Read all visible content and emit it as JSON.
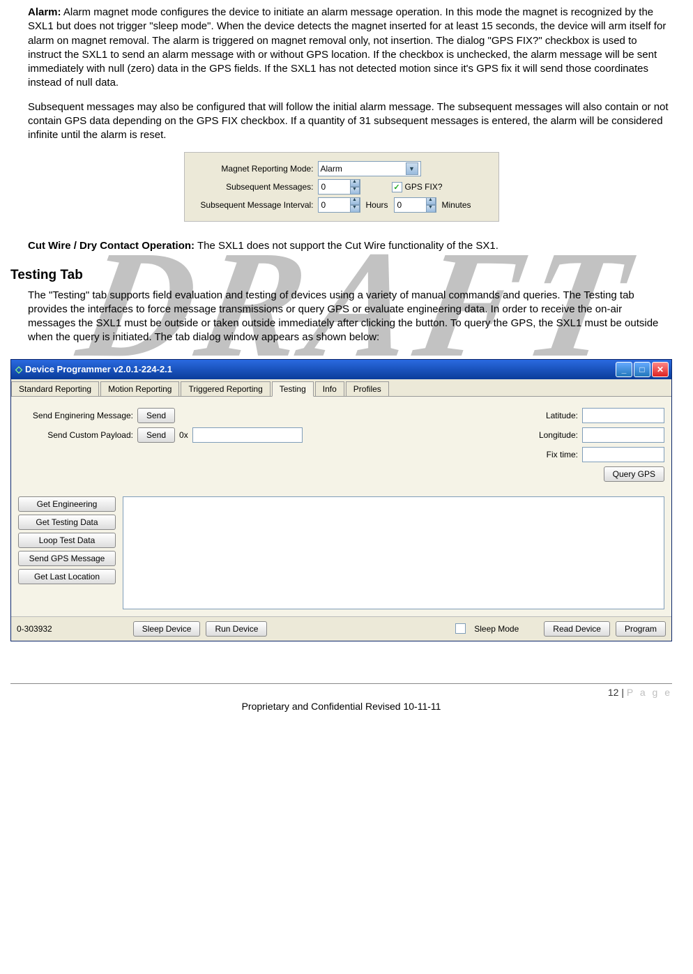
{
  "paragraphs": {
    "alarm_head": "Alarm:",
    "alarm_body": "  Alarm magnet mode configures the device to initiate an alarm message operation.  In this mode the magnet is recognized by the SXL1 but does not trigger \"sleep mode\".  When the device detects the magnet inserted for at least 15 seconds, the device will arm itself for alarm on magnet removal. The alarm is triggered on magnet removal only, not insertion.  The dialog \"GPS FIX?\" checkbox is used to instruct the SXL1 to send an alarm message with or without GPS location.  If the checkbox is unchecked, the alarm message will be sent immediately with null (zero) data in the GPS fields. If the SXL1 has not detected motion since it's GPS fix it will send those coordinates instead of null data.",
    "alarm_p2": "Subsequent messages may also be configured that will follow the initial alarm message.  The subsequent messages will also contain or not contain GPS data depending on the GPS FIX checkbox.  If a quantity of 31 subsequent messages is entered, the alarm will be considered infinite until the alarm is reset.",
    "cutwire_head": "Cut Wire / Dry Contact Operation:",
    "cutwire_body": "  The SXL1 does not support the Cut Wire functionality of the SX1.",
    "testing_heading": "Testing Tab",
    "testing_body": "The \"Testing\" tab supports field evaluation and testing of devices using a variety of manual commands and queries.  The Testing tab provides the interfaces to force message transmissions or query GPS or evaluate engineering data.  In order to receive the on-air messages the SXL1 must be outside or taken outside immediately after clicking the button.  To query the GPS, the SXL1 must be outside when the query is initiated.  The tab dialog window appears as shown below:"
  },
  "mini_panel": {
    "row1_label": "Magnet Reporting Mode:",
    "row1_value": "Alarm",
    "row2_label": "Subsequent Messages:",
    "row2_value": "0",
    "row2_check_label": "GPS FIX?",
    "row2_checked": true,
    "row3_label": "Subsequent Message Interval:",
    "row3_hours": "0",
    "row3_hours_label": "Hours",
    "row3_minutes": "0",
    "row3_minutes_label": "Minutes"
  },
  "app_window": {
    "title": "Device Programmer v2.0.1-224-2.1",
    "tabs": [
      "Standard Reporting",
      "Motion Reporting",
      "Triggered Reporting",
      "Testing",
      "Info",
      "Profiles"
    ],
    "active_tab": 3,
    "send_eng_label": "Send Enginering Message:",
    "send_eng_btn": "Send",
    "send_custom_label": "Send Custom Payload:",
    "send_custom_btn": "Send",
    "payload_prefix": "0x",
    "lat_label": "Latitude:",
    "lon_label": "Longitude:",
    "fix_label": "Fix time:",
    "query_gps_btn": "Query GPS",
    "side_buttons": [
      "Get Engineering",
      "Get Testing Data",
      "Loop Test Data",
      "Send GPS Message",
      "Get Last Location"
    ],
    "status_id": "0-303932",
    "sleep_device_btn": "Sleep Device",
    "run_device_btn": "Run Device",
    "sleep_mode_label": "Sleep Mode",
    "read_device_btn": "Read Device",
    "program_btn": "Program"
  },
  "footer": {
    "page_num": "12",
    "page_word": "P a g e",
    "confidential": "Proprietary and Confidential Revised 10-11-11"
  },
  "watermark": "DRAFT"
}
